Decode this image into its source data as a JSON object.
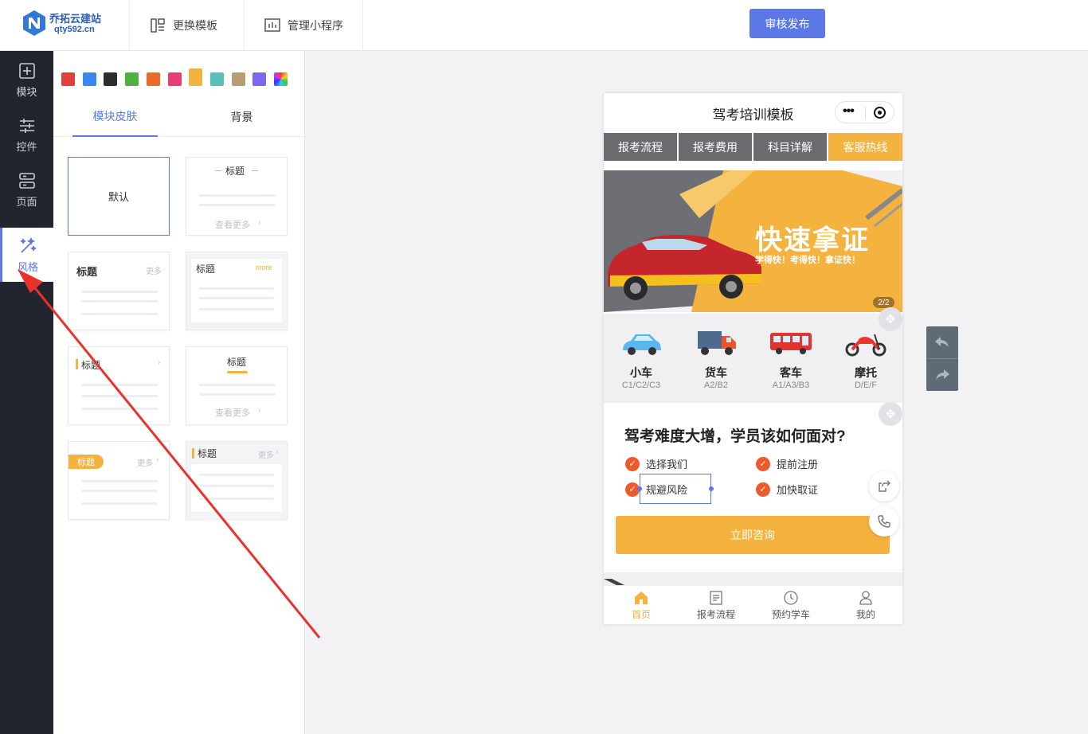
{
  "topbar": {
    "logo_name": "乔拓云建站",
    "logo_sub": "qty592.cn",
    "template_label": "更换模板",
    "manage_label": "管理小程序",
    "publish_label": "审核发布"
  },
  "nav": {
    "module": "模块",
    "control": "控件",
    "page": "页面",
    "style": "风格"
  },
  "style_panel": {
    "swatches": [
      "#e0413a",
      "#3b86f0",
      "#2d2d30",
      "#4db33d",
      "#ee6a2a",
      "#ea3d77",
      "#f4b23e",
      "#58c0b4",
      "#b69d72",
      "#7b67f0"
    ],
    "selected_swatch": "#f4b23e",
    "tab_skin": "模块皮肤",
    "tab_bg": "背景",
    "cards": {
      "default": "默认",
      "title": "标题",
      "view_more": "查看更多",
      "more": "更多",
      "more_en": "more"
    }
  },
  "phone": {
    "title": "驾考培训模板",
    "tabs": [
      "报考流程",
      "报考费用",
      "科目详解",
      "客服热线"
    ],
    "banner_big": "快速拿证",
    "banner_small": "学得快！考得快！拿证快！",
    "banner_page": "2/2",
    "vehicles": [
      {
        "name": "小车",
        "code": "C1/C2/C3",
        "icon": "car-icon"
      },
      {
        "name": "货车",
        "code": "A2/B2",
        "icon": "truck-icon"
      },
      {
        "name": "客车",
        "code": "A1/A3/B3",
        "icon": "bus-icon"
      },
      {
        "name": "摩托",
        "code": "D/E/F",
        "icon": "motorcycle-icon"
      }
    ],
    "article_title": "驾考难度大增，学员该如何面对?",
    "checks": [
      "选择我们",
      "提前注册",
      "规避风险",
      "加快取证"
    ],
    "consult_label": "立即咨询",
    "tabbar": [
      "首页",
      "报考流程",
      "预约学车",
      "我的"
    ]
  },
  "colors": {
    "accent": "#5b78e6",
    "theme": "#f4b23e",
    "check": "#ef5a2c",
    "nav_bg": "#22252d",
    "arrow": "#e8322b"
  }
}
